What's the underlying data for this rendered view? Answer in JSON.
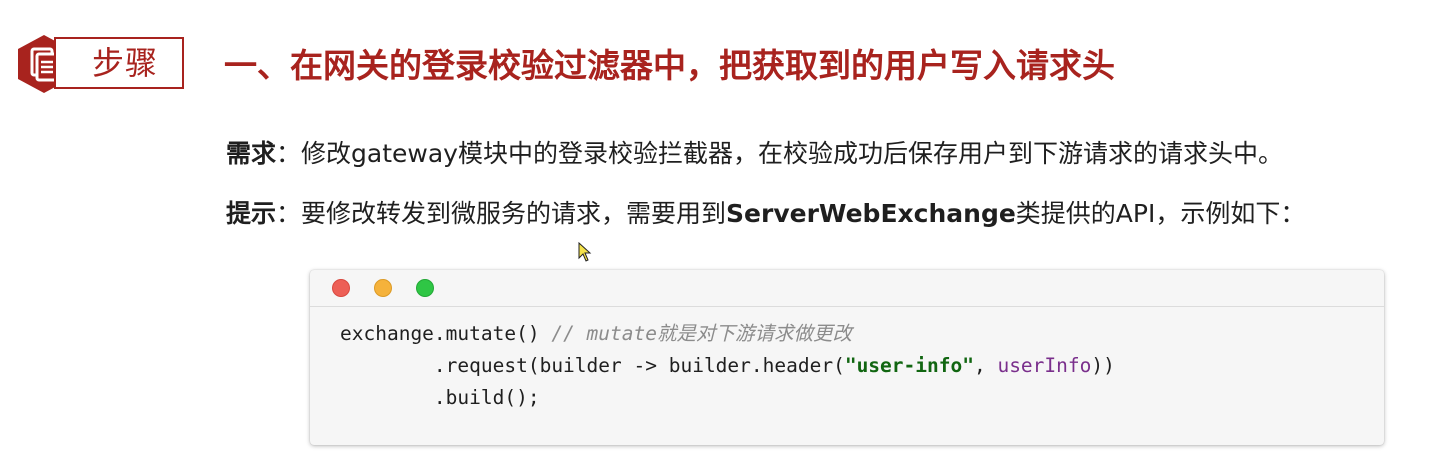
{
  "step_badge": {
    "label": "步骤",
    "icon": "document-icon",
    "color": "#a8231e"
  },
  "title": "一、在网关的登录校验过滤器中，把获取到的用户写入请求头",
  "requirement": {
    "label": "需求",
    "separator": "：",
    "text": "修改gateway模块中的登录校验拦截器，在校验成功后保存用户到下游请求的请求头中。"
  },
  "hint": {
    "label": "提示",
    "separator": "：",
    "text_before": "要修改转发到微服务的请求，需要用到",
    "highlight": "ServerWebExchange",
    "text_after": "类提供的API，示例如下："
  },
  "code_window": {
    "buttons": [
      "close",
      "minimize",
      "maximize"
    ],
    "lines": [
      {
        "code": "exchange.mutate() ",
        "comment": "// mutate就是对下游请求做更改"
      },
      {
        "indent": "        ",
        "before": ".request(builder -> builder.header(",
        "string": "\"user-info\"",
        "comma": ", ",
        "variable": "userInfo",
        "after": "))"
      },
      {
        "indent": "        ",
        "code": ".build();"
      }
    ]
  }
}
